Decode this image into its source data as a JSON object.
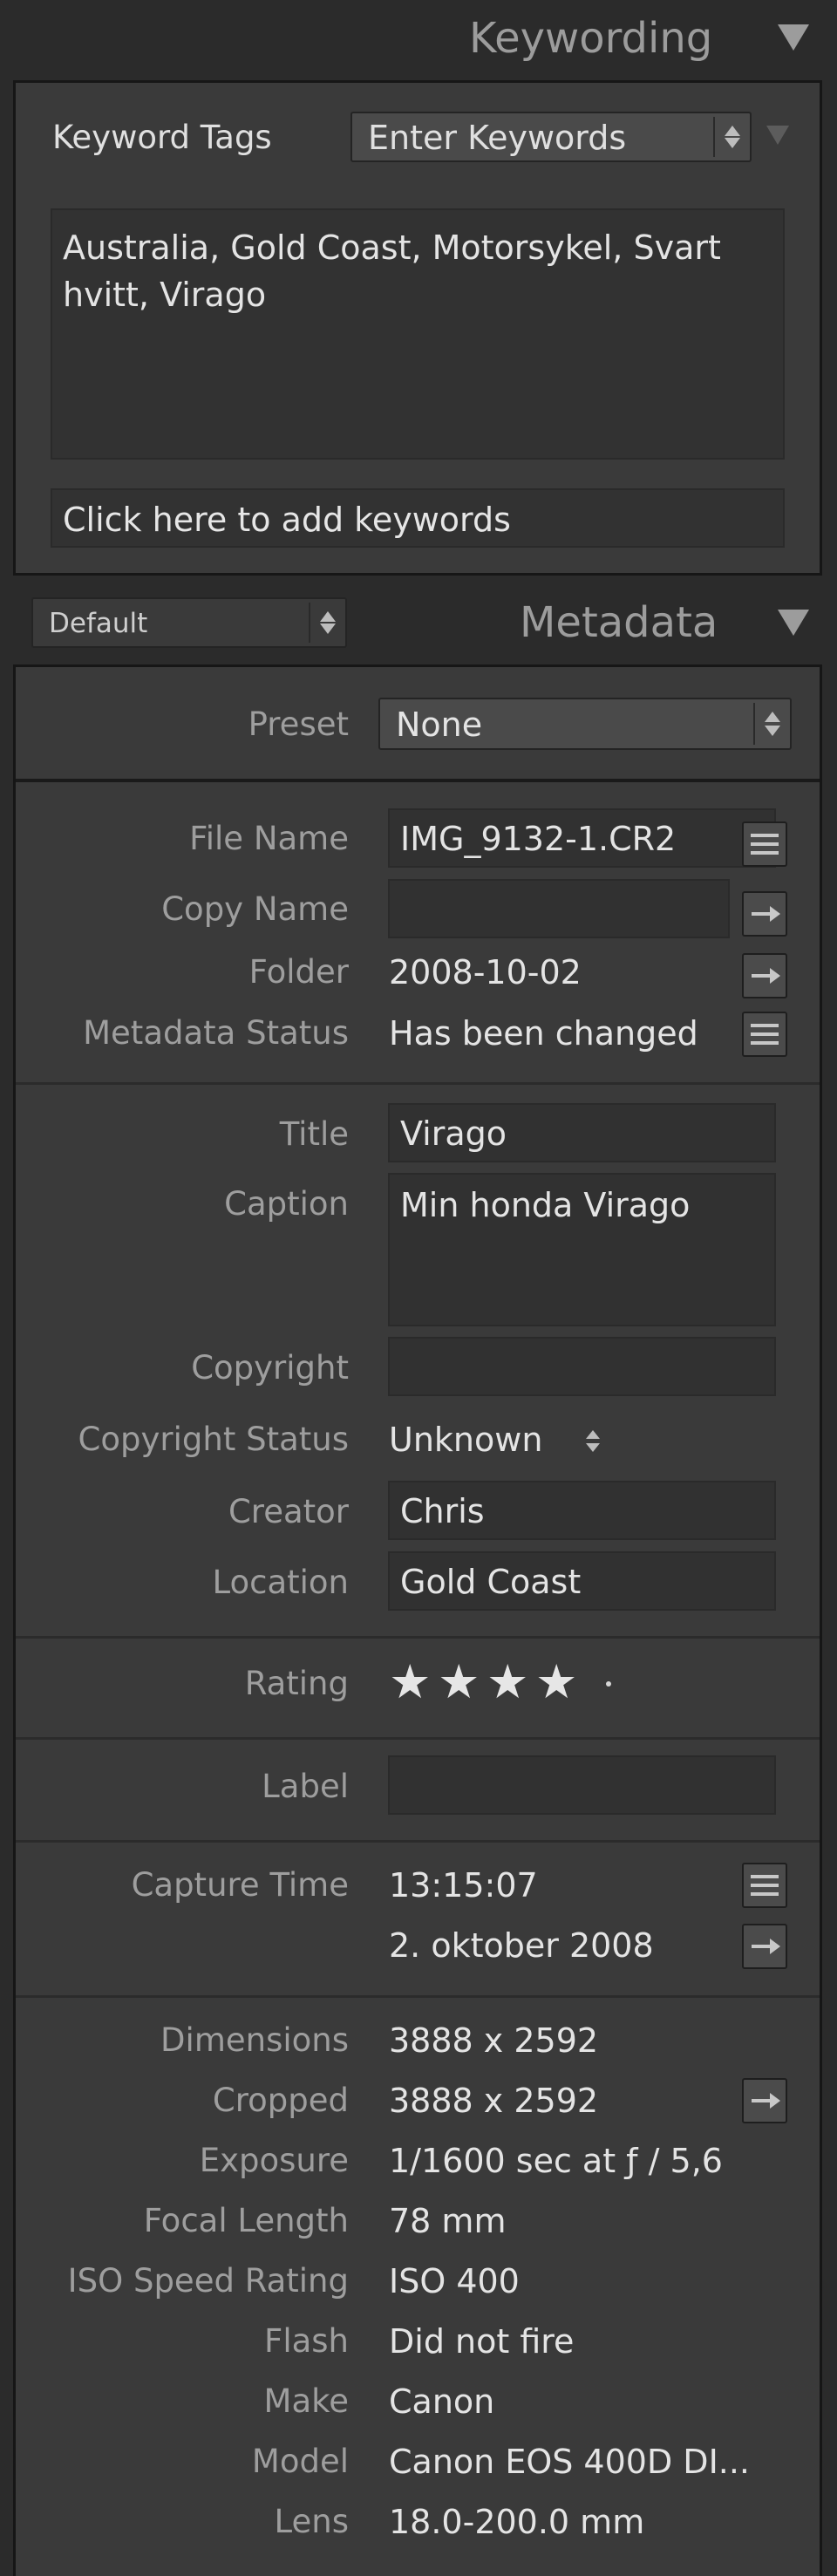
{
  "keywording": {
    "title": "Keywording",
    "keyword_tags_label": "Keyword Tags",
    "keyword_mode": "Enter Keywords",
    "keywords_text": "Australia, Gold Coast, Motorsykel, Svart hvitt, Virago",
    "add_keywords_placeholder": "Click here to add keywords"
  },
  "metadata": {
    "title": "Metadata",
    "view_select": "Default",
    "preset_label": "Preset",
    "preset_value": "None",
    "file_name_label": "File Name",
    "file_name": "IMG_9132-1.CR2",
    "copy_name_label": "Copy Name",
    "copy_name": "",
    "folder_label": "Folder",
    "folder": "2008-10-02",
    "metadata_status_label": "Metadata Status",
    "metadata_status": "Has been changed",
    "title_label": "Title",
    "title_value": "Virago",
    "caption_label": "Caption",
    "caption": "Min honda Virago",
    "copyright_label": "Copyright",
    "copyright": "",
    "copyright_status_label": "Copyright Status",
    "copyright_status": "Unknown",
    "creator_label": "Creator",
    "creator": "Chris",
    "location_label": "Location",
    "location": "Gold Coast",
    "rating_label": "Rating",
    "rating": 4,
    "rating_max": 5,
    "label_label": "Label",
    "label_value": "",
    "capture_time_label": "Capture Time",
    "capture_time": "13:15:07",
    "capture_date": "2. oktober 2008",
    "dimensions_label": "Dimensions",
    "dimensions": "3888 x 2592",
    "cropped_label": "Cropped",
    "cropped": "3888 x 2592",
    "exposure_label": "Exposure",
    "exposure": "1/1600 sec at ƒ / 5,6",
    "focal_length_label": "Focal Length",
    "focal_length": "78 mm",
    "iso_label": "ISO Speed Rating",
    "iso": "ISO 400",
    "flash_label": "Flash",
    "flash": "Did not fire",
    "make_label": "Make",
    "make": "Canon",
    "model_label": "Model",
    "model": "Canon EOS 400D DI...",
    "lens_label": "Lens",
    "lens": "18.0-200.0 mm"
  },
  "icons": {
    "panel_toggle": "triangle-down-icon",
    "list_action": "list-icon",
    "go_to": "arrow-right-icon",
    "stepper": "updown-stepper-icon"
  },
  "colors": {
    "background": "#2b2b2b",
    "panel": "#3a3a3a",
    "label_text": "#9e9e9e",
    "value_text": "#e4e4e4"
  }
}
